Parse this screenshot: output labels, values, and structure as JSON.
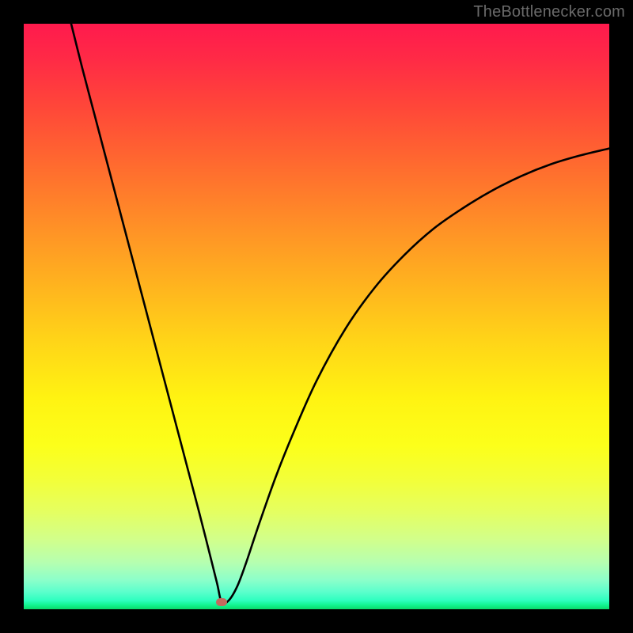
{
  "watermark": {
    "text": "TheBottlenecker.com"
  },
  "marker": {
    "x_pct": 33.8,
    "y_pct": 98.8
  },
  "chart_data": {
    "type": "line",
    "title": "",
    "xlabel": "",
    "ylabel": "",
    "xlim": [
      0,
      100
    ],
    "ylim": [
      0,
      100
    ],
    "legend": false,
    "grid": false,
    "background": "rainbow-vertical-gradient",
    "series": [
      {
        "name": "bottleneck-curve",
        "x": [
          8.1,
          10,
          12,
          14,
          16,
          18,
          20,
          22,
          24,
          26,
          28,
          30,
          31.5,
          33,
          33.8,
          35,
          36.5,
          38,
          40,
          43,
          46,
          50,
          55,
          60,
          65,
          70,
          75,
          80,
          85,
          90,
          95,
          100
        ],
        "y": [
          100,
          92.4,
          84.8,
          77.2,
          69.6,
          62.0,
          54.4,
          46.8,
          39.2,
          31.6,
          24.0,
          16.4,
          10.5,
          4.5,
          1.2,
          1.5,
          4.0,
          8.0,
          14.0,
          22.5,
          30.0,
          39.0,
          48.0,
          55.0,
          60.5,
          65.0,
          68.5,
          71.5,
          74.0,
          76.0,
          77.5,
          78.7
        ]
      }
    ],
    "annotations": [
      {
        "type": "marker",
        "x": 33.8,
        "y": 1.2,
        "label": "optimal-point"
      }
    ]
  }
}
